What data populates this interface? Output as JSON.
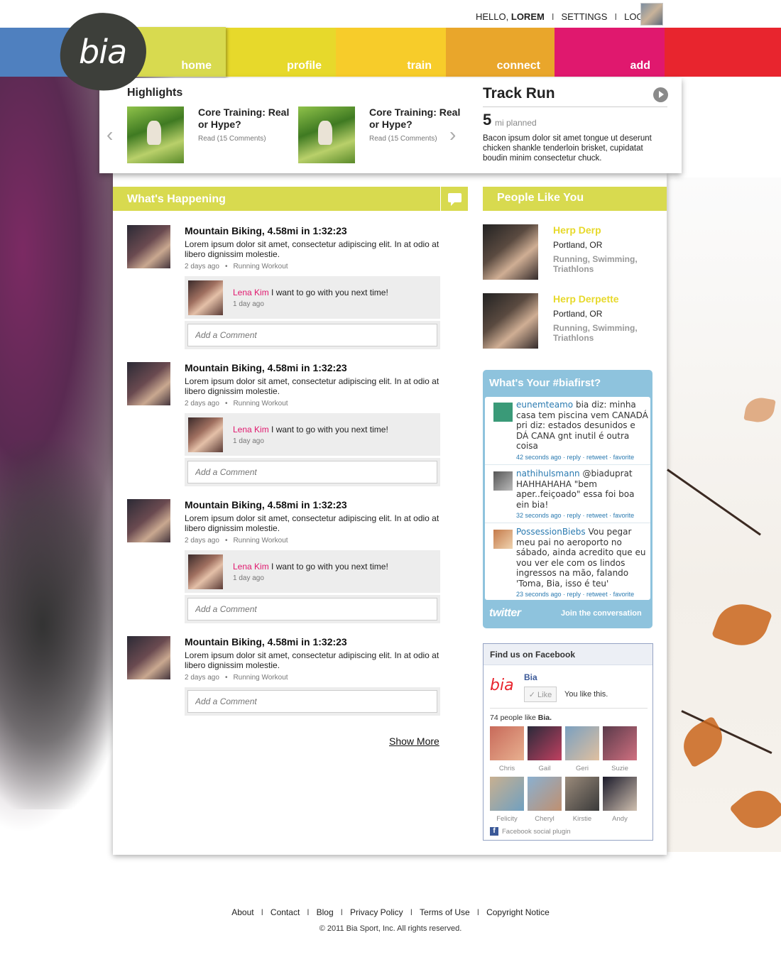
{
  "account": {
    "hello_prefix": "HELLO,",
    "username": "LOREM",
    "separator": "I",
    "settings": "SETTINGS",
    "logout": "LOGOUT"
  },
  "logo": {
    "text": "bia"
  },
  "nav": {
    "home": "home",
    "profile": "profile",
    "train": "train",
    "connect": "connect",
    "add": "add"
  },
  "highlights": {
    "title": "Highlights",
    "items": [
      {
        "title": "Core Training: Real or Hype?",
        "meta": "Read (15 Comments)"
      },
      {
        "title": "Core Training: Real or Hype?",
        "meta": "Read (15 Comments)"
      }
    ]
  },
  "track_run": {
    "title": "Track Run",
    "miles": "5",
    "unit": "mi planned",
    "description": "Bacon ipsum dolor sit amet tongue ut deserunt chicken shankle tenderloin brisket, cupidatat boudin minim consectetur chuck."
  },
  "whats_happening": {
    "title": "What's Happening",
    "items": [
      {
        "title": "Mountain Biking, 4.58mi in 1:32:23",
        "body": "Lorem ipsum dolor sit amet, consectetur adipiscing elit. In at odio at libero dignissim molestie.",
        "time": "2 days ago",
        "type": "Running Workout",
        "comment": {
          "name": "Lena Kim",
          "text": "I want to go with you next time!",
          "time": "1 day ago"
        }
      },
      {
        "title": "Mountain Biking, 4.58mi in 1:32:23",
        "body": "Lorem ipsum dolor sit amet, consectetur adipiscing elit. In at odio at libero dignissim molestie.",
        "time": "2 days ago",
        "type": "Running Workout",
        "comment": {
          "name": "Lena Kim",
          "text": "I want to go with you next time!",
          "time": "1 day ago"
        }
      },
      {
        "title": "Mountain Biking, 4.58mi in 1:32:23",
        "body": "Lorem ipsum dolor sit amet, consectetur adipiscing elit. In at odio at libero dignissim molestie.",
        "time": "2 days ago",
        "type": "Running Workout",
        "comment": {
          "name": "Lena Kim",
          "text": "I want to go with you next time!",
          "time": "1 day ago"
        }
      },
      {
        "title": "Mountain Biking, 4.58mi in 1:32:23",
        "body": "Lorem ipsum dolor sit amet, consectetur adipiscing elit. In at odio at libero dignissim molestie.",
        "time": "2 days ago",
        "type": "Running Workout"
      }
    ],
    "add_comment_placeholder": "Add a Comment",
    "meta_separator": "•",
    "show_more": "Show More"
  },
  "people_like_you": {
    "title": "People Like You",
    "people": [
      {
        "name": "Herp Derp",
        "location": "Portland, OR",
        "sports": "Running, Swimming, Triathlons"
      },
      {
        "name": "Herp Derpette",
        "location": "Portland, OR",
        "sports": "Running, Swimming, Triathlons"
      }
    ]
  },
  "twitter": {
    "title": "What's Your #biafirst?",
    "tweets": [
      {
        "user": "eunemteamo",
        "text": "bia diz: minha casa tem piscina vem CANADÁ pri diz: estados desunidos e DÁ CANA gnt inutil é outra coisa",
        "meta": "42 seconds ago · reply · retweet · favorite"
      },
      {
        "user": "nathihulsmann",
        "text": "@biaduprat HAHHAHAHA \"bem aper..feiçoado\" essa foi boa ein bia!",
        "meta": "32 seconds ago · reply · retweet · favorite"
      },
      {
        "user": "PossessionBiebs",
        "text": "Vou pegar meu pai no aeroporto no sábado, ainda acredito que eu vou ver ele com os lindos ingressos na mão, falando 'Toma, Bia, isso é teu'",
        "meta": "23 seconds ago · reply · retweet · favorite"
      }
    ],
    "footer_logo": "twitter",
    "join": "Join the conversation"
  },
  "facebook": {
    "header": "Find us on Facebook",
    "logo": "bia",
    "page_name": "Bia",
    "like_button": "✓ Like",
    "you_like": "You like this.",
    "count_prefix": "74 people like",
    "count_name": "Bia.",
    "friends": [
      "Chris",
      "Gail",
      "Geri",
      "Suzie",
      "Felicity",
      "Cheryl",
      "Kirstie",
      "Andy"
    ],
    "plugin": "Facebook social plugin"
  },
  "footer": {
    "links": [
      "About",
      "Contact",
      "Blog",
      "Privacy Policy",
      "Terms of Use",
      "Copyright Notice"
    ],
    "separator": "I",
    "copyright": "© 2011 Bia Sport, Inc. All rights reserved."
  }
}
